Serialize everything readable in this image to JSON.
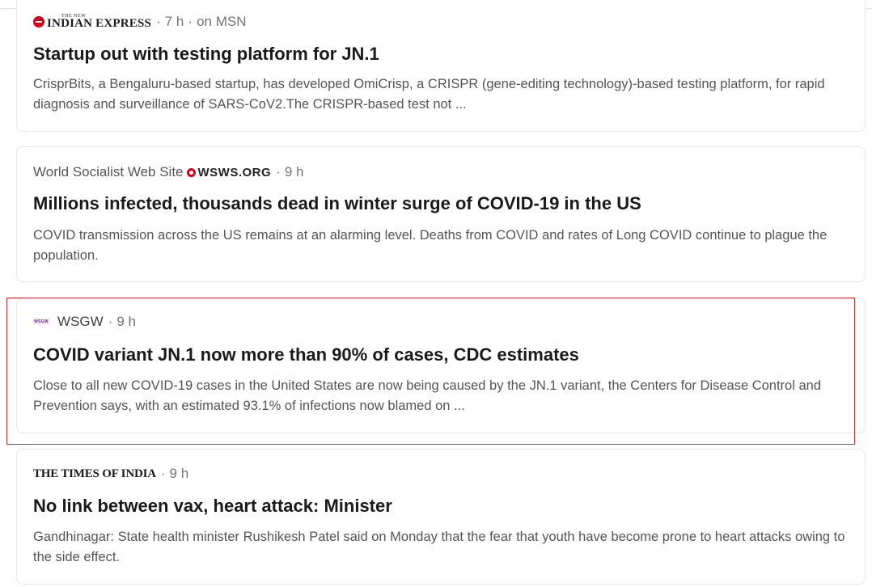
{
  "colors": {
    "highlight_border": "#d62a2a",
    "brand_red": "#d0021b",
    "wsgw_purple": "#6a1b9a"
  },
  "articles": [
    {
      "logo": {
        "small": "THE NEW",
        "big": "INDIAN EXPRESS"
      },
      "separator": "·",
      "time": "7 h",
      "via": "on MSN",
      "headline": "Startup out with testing platform for JN.1",
      "snippet": "CrisprBits, a Bengaluru-based startup, has developed OmiCrisp, a CRISPR (gene-editing technology)-based testing platform, for rapid diagnosis and surveillance of SARS-CoV2.The CRISPR-based test not ..."
    },
    {
      "logo": {
        "name": "World Socialist Web Site",
        "org": "WSWS.ORG"
      },
      "separator": "·",
      "time": "9 h",
      "headline": "Millions infected, thousands dead in winter surge of COVID-19 in the US",
      "snippet": "COVID transmission across the US remains at an alarming level. Deaths from COVID and rates of Long COVID continue to plague the population."
    },
    {
      "logo": {
        "mark": "WSGW"
      },
      "source": "WSGW",
      "separator": "·",
      "time": "9 h",
      "headline": "COVID variant JN.1 now more than 90% of cases, CDC estimates",
      "snippet": "Close to all new COVID-19 cases in the United States are now being caused by the JN.1 variant, the Centers for Disease Control and Prevention says, with an estimated 93.1% of infections now blamed on ..."
    },
    {
      "logo": {
        "name": "THE TIMES OF INDIA"
      },
      "separator": "·",
      "time": "9 h",
      "headline": "No link between vax, heart attack: Minister",
      "snippet": "Gandhinagar: State health minister Rushikesh Patel said on Monday that the fear that youth have become prone to heart attacks owing to the side effect."
    }
  ]
}
